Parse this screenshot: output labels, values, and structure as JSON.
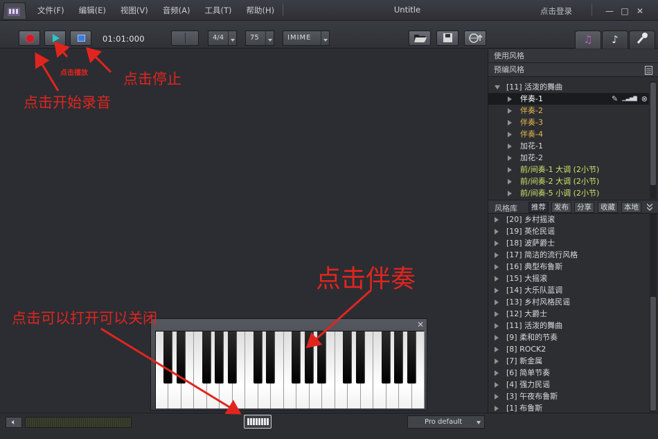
{
  "window": {
    "title": "Untitle",
    "login": "点击登录"
  },
  "menu": [
    "文件(F)",
    "编辑(E)",
    "视图(V)",
    "音频(A)",
    "工具(T)",
    "帮助(H)"
  ],
  "window_controls": [
    "—",
    "□",
    "✕"
  ],
  "toolbar": {
    "time": "01:01:000",
    "time_signature": "4/4",
    "tempo": "75",
    "input_method": "IMIME"
  },
  "right_panel": {
    "used_styles_title": "使用风格",
    "preset_styles_title": "预编风格",
    "current_style": "[11] 活泼的舞曲",
    "style_items": [
      {
        "label": "伴奏-1",
        "color": "#ffffff"
      },
      {
        "label": "伴奏-2",
        "color": "#e8b84a"
      },
      {
        "label": "伴奏-3",
        "color": "#e8b84a"
      },
      {
        "label": "伴奏-4",
        "color": "#e8b84a"
      },
      {
        "label": "加花-1",
        "color": "#d7dade"
      },
      {
        "label": "加花-2",
        "color": "#d7dade"
      },
      {
        "label": "前/间奏-1 大调 (2小节)",
        "color": "#cfe36a"
      },
      {
        "label": "前/间奏-2 大调 (2小节)",
        "color": "#cfe36a"
      },
      {
        "label": "前/间奏-5 小调 (2小节)",
        "color": "#cfe36a"
      }
    ],
    "library_label": "风格库",
    "library_tabs": [
      "推荐",
      "发布",
      "分享",
      "收藏",
      "本地"
    ],
    "library_items": [
      "[20] 乡村摇滚",
      "[19] 英伦民谣",
      "[18] 波萨爵士",
      "[17] 简洁的流行风格",
      "[16] 典型布鲁斯",
      "[15] 大摇滚",
      "[14] 大乐队蓝调",
      "[13] 乡村风格民谣",
      "[12] 大爵士",
      "[11] 活泼的舞曲",
      "[9] 柔和的节奏",
      "[8] ROCK2",
      "[7] 新金属",
      "[6] 简单节奏",
      "[4] 强力民谣",
      "[3] 午夜布鲁斯",
      "[1] 布鲁斯"
    ]
  },
  "statusbar": {
    "preset": "Pro default"
  },
  "annotations": {
    "record": "点击开始录音",
    "play": "点击播放",
    "stop": "点击停止",
    "accompany": "点击伴奏",
    "toggle": "点击可以打开可以关闭"
  },
  "colors": {
    "annotation": "#e0251f",
    "record": "#d6192a",
    "play": "#28c6c6",
    "stop": "#3d7be0"
  }
}
